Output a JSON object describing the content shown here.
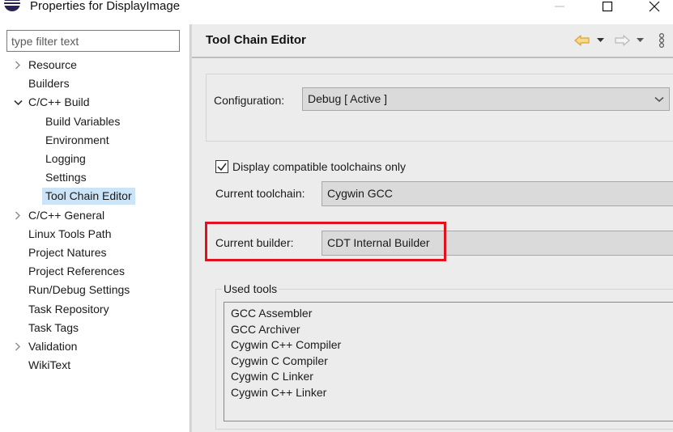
{
  "window": {
    "title": "Properties for DisplayImage",
    "controls": {
      "minimize": "minimize",
      "maximize": "maximize",
      "close": "close"
    }
  },
  "sidebar": {
    "filter_placeholder": "type filter text",
    "filter_value": "",
    "items": [
      {
        "label": "Resource",
        "level": 0,
        "twisty": "collapsed"
      },
      {
        "label": "Builders",
        "level": 0,
        "twisty": "none"
      },
      {
        "label": "C/C++ Build",
        "level": 0,
        "twisty": "expanded"
      },
      {
        "label": "Build Variables",
        "level": 1,
        "twisty": "none"
      },
      {
        "label": "Environment",
        "level": 1,
        "twisty": "none"
      },
      {
        "label": "Logging",
        "level": 1,
        "twisty": "none"
      },
      {
        "label": "Settings",
        "level": 1,
        "twisty": "none"
      },
      {
        "label": "Tool Chain Editor",
        "level": 1,
        "twisty": "none",
        "selected": true
      },
      {
        "label": "C/C++ General",
        "level": 0,
        "twisty": "collapsed"
      },
      {
        "label": "Linux Tools Path",
        "level": 0,
        "twisty": "none"
      },
      {
        "label": "Project Natures",
        "level": 0,
        "twisty": "none"
      },
      {
        "label": "Project References",
        "level": 0,
        "twisty": "none"
      },
      {
        "label": "Run/Debug Settings",
        "level": 0,
        "twisty": "none"
      },
      {
        "label": "Task Repository",
        "level": 0,
        "twisty": "none"
      },
      {
        "label": "Task Tags",
        "level": 0,
        "twisty": "none"
      },
      {
        "label": "Validation",
        "level": 0,
        "twisty": "collapsed"
      },
      {
        "label": "WikiText",
        "level": 0,
        "twisty": "none"
      }
    ]
  },
  "page": {
    "title": "Tool Chain Editor",
    "toolbar": {
      "back_icon": "back-arrow-icon",
      "forward_icon": "forward-arrow-icon",
      "menu_icon": "view-menu-icon"
    },
    "configuration": {
      "label": "Configuration:",
      "value": "Debug  [ Active ]"
    },
    "compatible_only": {
      "label": "Display compatible toolchains only",
      "checked": true
    },
    "toolchain": {
      "label": "Current toolchain:",
      "value": "Cygwin GCC"
    },
    "builder": {
      "label": "Current builder:",
      "value": "CDT Internal Builder"
    },
    "used_tools": {
      "label": "Used tools",
      "items": [
        "GCC Assembler",
        "GCC Archiver",
        "Cygwin C++ Compiler",
        "Cygwin C Compiler",
        "Cygwin C Linker",
        "Cygwin C++ Linker"
      ]
    }
  },
  "colors": {
    "highlight": "#e0121f",
    "selection": "#cce4f7",
    "panel_bg": "#ececec",
    "field_bg": "#dadada"
  }
}
